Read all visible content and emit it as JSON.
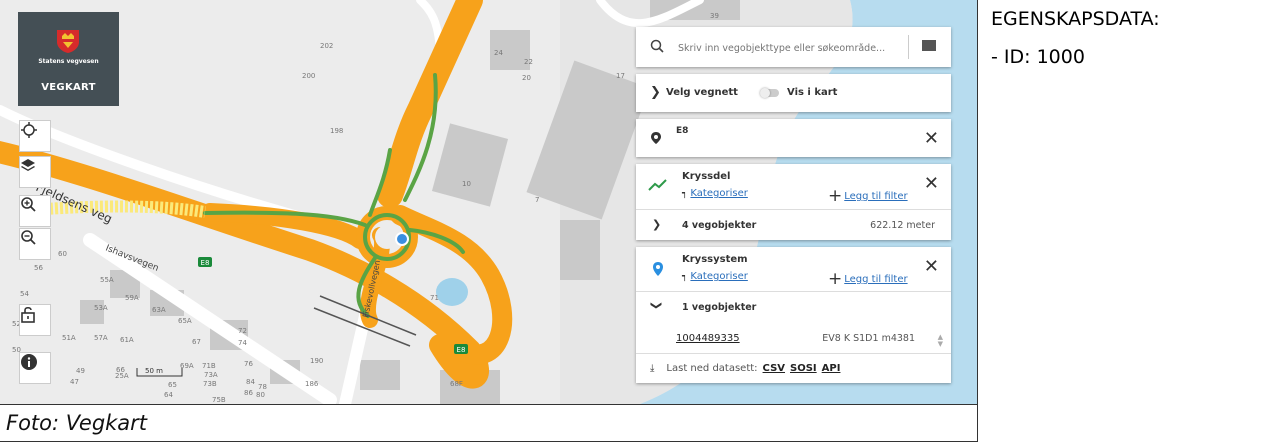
{
  "map": {
    "app_title": "VEGKART",
    "org": "Statens vegvesen",
    "road_labels": [
      "Fjeldsens veg",
      "Ishavsvegen",
      "Fiskevollvegen"
    ],
    "road_badges": [
      "E8",
      "E8"
    ],
    "scale": "50 m",
    "house_numbers": [
      "202",
      "200",
      "198",
      "39",
      "24",
      "22",
      "20",
      "17",
      "10",
      "56",
      "60",
      "55A",
      "59A",
      "54",
      "53A",
      "63A",
      "65A",
      "52",
      "57A",
      "51A",
      "61A",
      "67",
      "72",
      "74",
      "50",
      "49",
      "66",
      "69A",
      "71B",
      "73A",
      "73B",
      "47",
      "76",
      "190",
      "186",
      "65",
      "84",
      "78",
      "86",
      "80",
      "64",
      "71",
      "7",
      "68F",
      "25A",
      "75B"
    ]
  },
  "toolbar": {
    "locate_icon": "crosshair-icon",
    "layers_icon": "layers-icon",
    "zoom_in_icon": "zoom-in-icon",
    "zoom_out_icon": "zoom-out-icon",
    "lock_icon": "lock-icon",
    "info_icon": "info-icon"
  },
  "search": {
    "placeholder": "Skriv inn vegobjekttype eller søkeområde..."
  },
  "vegnett": {
    "label": "Velg vegnett",
    "toggle_label": "Vis i kart"
  },
  "location": {
    "label": "E8"
  },
  "kryssdel": {
    "title": "Kryssdel",
    "categorize": "Kategoriser",
    "add_filter": "Legg til filter",
    "count_label": "4 vegobjekter",
    "length": "622.12 meter"
  },
  "kryssystem": {
    "title": "Kryssystem",
    "categorize": "Kategoriser",
    "add_filter": "Legg til filter",
    "count_label": "1 vegobjekter",
    "object_id": "1004489335",
    "object_ref": "EV8 K S1D1 m4381"
  },
  "download": {
    "label": "Last ned datasett:",
    "formats": [
      "CSV",
      "SOSI",
      "API"
    ]
  },
  "caption": "Foto: Vegkart",
  "properties": {
    "title": "EGENSKAPSDATA:",
    "item": "- ID: 1000"
  },
  "colors": {
    "road_orange": "#f7a21b",
    "road_green": "#5aa445",
    "water": "#b7dcef",
    "accent_blue": "#2a6ebb",
    "logo_bg": "#444f55"
  }
}
